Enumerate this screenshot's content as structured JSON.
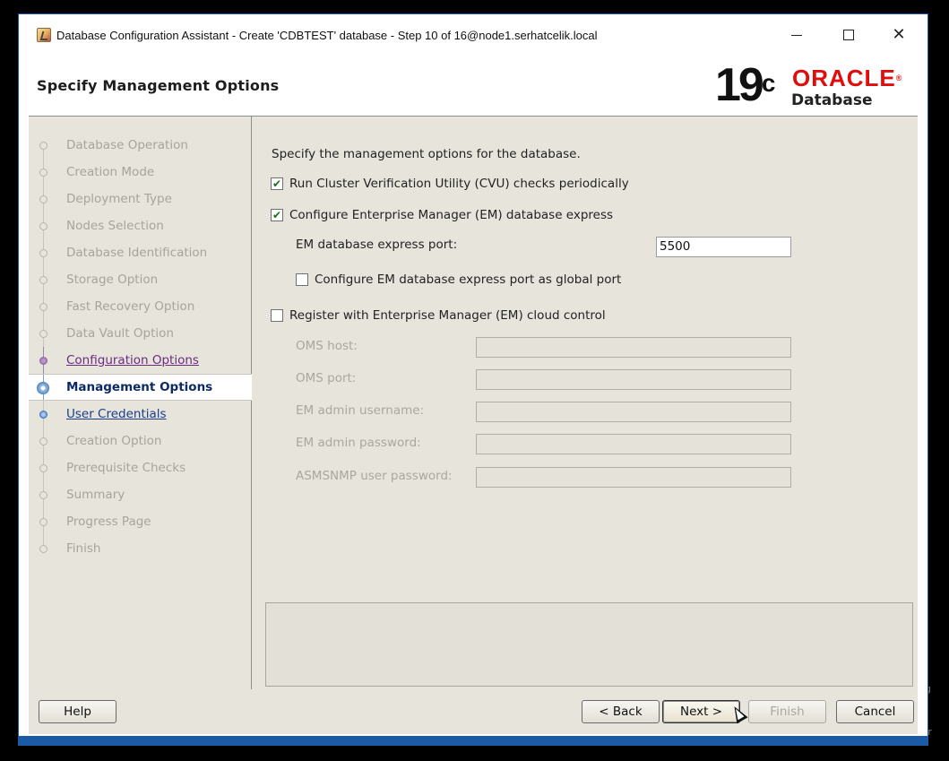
{
  "window": {
    "title": "Database Configuration Assistant - Create 'CDBTEST' database - Step 10 of 16@node1.serhatcelik.local",
    "minimize_glyph": "",
    "close_glyph": "✕"
  },
  "header": {
    "heading": "Specify Management Options",
    "logo_version": "19",
    "logo_version_suffix": "c",
    "logo_brand": "ORACLE",
    "logo_brand_reg": "®",
    "logo_product": "Database"
  },
  "sidebar": {
    "steps": [
      {
        "label": "Database Operation",
        "state": "disabled"
      },
      {
        "label": "Creation Mode",
        "state": "disabled"
      },
      {
        "label": "Deployment Type",
        "state": "disabled"
      },
      {
        "label": "Nodes Selection",
        "state": "disabled"
      },
      {
        "label": "Database Identification",
        "state": "disabled"
      },
      {
        "label": "Storage Option",
        "state": "disabled"
      },
      {
        "label": "Fast Recovery Option",
        "state": "disabled"
      },
      {
        "label": "Data Vault Option",
        "state": "disabled"
      },
      {
        "label": "Configuration Options",
        "state": "visited"
      },
      {
        "label": "Management Options",
        "state": "current"
      },
      {
        "label": "User Credentials",
        "state": "next"
      },
      {
        "label": "Creation Option",
        "state": "disabled"
      },
      {
        "label": "Prerequisite Checks",
        "state": "disabled"
      },
      {
        "label": "Summary",
        "state": "disabled"
      },
      {
        "label": "Progress Page",
        "state": "disabled"
      },
      {
        "label": "Finish",
        "state": "disabled"
      }
    ]
  },
  "content": {
    "intro": "Specify the management options for the database.",
    "cvu_check_label": "Run Cluster Verification Utility (CVU) checks periodically",
    "cvu_checked": "✔",
    "em_express_label": "Configure Enterprise Manager (EM) database express",
    "em_express_checked": "✔",
    "em_port_label": "EM database express port:",
    "em_port_value": "5500",
    "global_port_label": "Configure EM database express port as global port",
    "cloud_control_label": "Register with Enterprise Manager (EM) cloud control",
    "oms_host_label": "OMS host:",
    "oms_port_label": "OMS port:",
    "em_admin_user_label": "EM admin username:",
    "em_admin_pass_label": "EM admin password:",
    "asmsnmp_pass_label": "ASMSNMP user password:"
  },
  "footer": {
    "help_label": "Help",
    "back_label": "< Back",
    "next_label": "Next >",
    "finish_label": "Finish",
    "cancel_label": "Cancel"
  },
  "desktop": {
    "edge_text_1": "g",
    "edge_text_2": "Ir"
  }
}
